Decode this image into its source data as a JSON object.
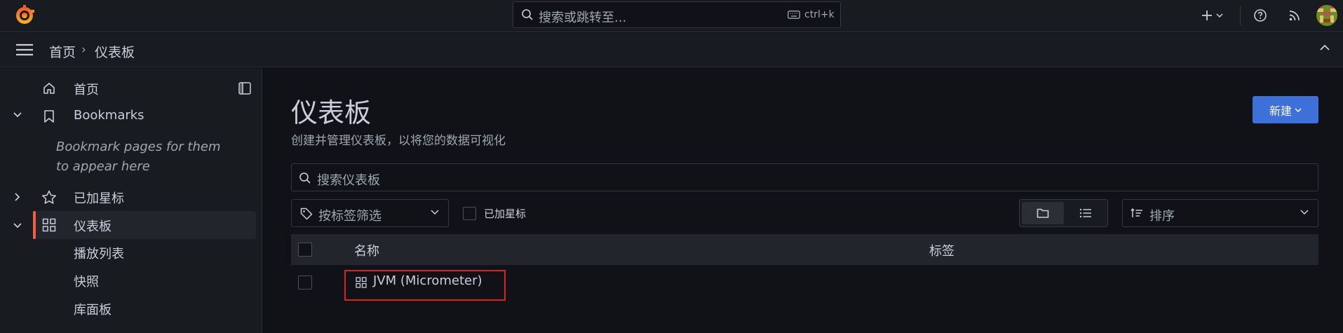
{
  "topbar": {
    "search_placeholder": "搜索或跳转至...",
    "search_shortcut": "ctrl+k"
  },
  "breadcrumb": {
    "home": "首页",
    "separator": "›",
    "current": "仪表板"
  },
  "sidebar": {
    "items": [
      {
        "label": "首页",
        "icon": "home-icon"
      },
      {
        "label": "Bookmarks",
        "icon": "bookmark-icon"
      },
      {
        "label": "已加星标",
        "icon": "star-icon"
      },
      {
        "label": "仪表板",
        "icon": "apps-icon",
        "active": true
      },
      {
        "label": "播放列表"
      },
      {
        "label": "快照"
      },
      {
        "label": "库面板"
      }
    ],
    "bookmark_hint": "Bookmark pages for them to appear here"
  },
  "main": {
    "title": "仪表板",
    "subtitle": "创建并管理仪表板，以将您的数据可视化",
    "new_button": "新建",
    "search_placeholder": "搜索仪表板",
    "tag_filter_placeholder": "按标签筛选",
    "starred_label": "已加星标",
    "sort_placeholder": "排序",
    "table": {
      "columns": [
        "名称",
        "标签"
      ],
      "rows": [
        {
          "title": "JVM (Micrometer)",
          "tags": ""
        }
      ]
    }
  },
  "colors": {
    "background": "#111217",
    "panel": "#181b1f",
    "primary": "#3d71d9",
    "active_accent": "#f55f3e",
    "highlight": "#e02020"
  }
}
